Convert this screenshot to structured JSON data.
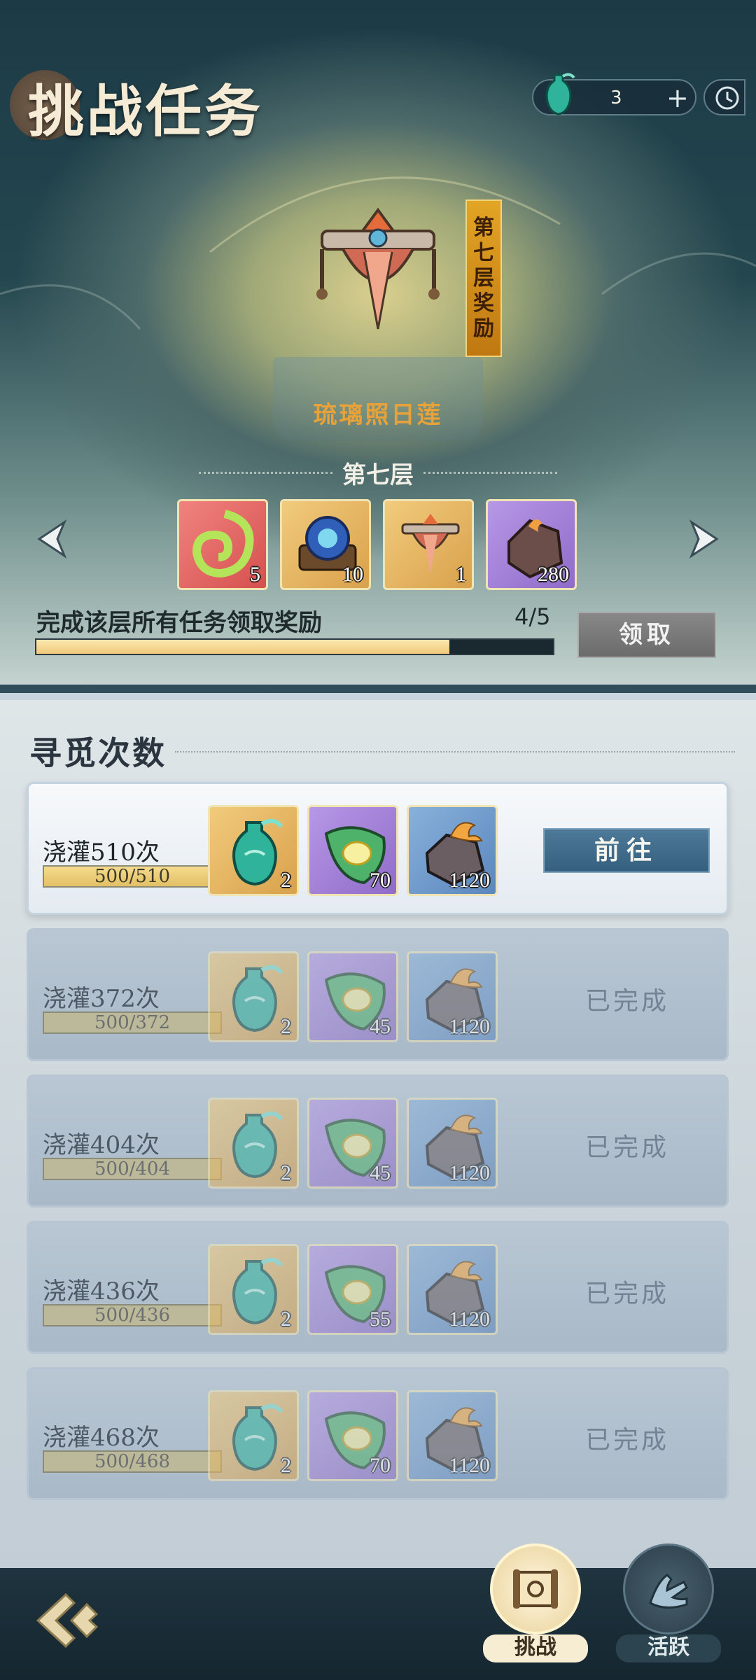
{
  "header": {
    "title": "挑战任务",
    "currency": {
      "icon": "jade-vase-icon",
      "count": "3",
      "plus": "+"
    },
    "clock_icon": "clock-icon"
  },
  "featured": {
    "item_name": "琉璃照日莲",
    "banner_chars": [
      "第",
      "七",
      "层",
      "奖",
      "励"
    ]
  },
  "floor": {
    "label": "第七层",
    "rewards": [
      {
        "icon": "green-swirl-emblem-icon",
        "qty": "5",
        "rarity": "red"
      },
      {
        "icon": "crystal-orb-box-icon",
        "qty": "10",
        "rarity": "gold"
      },
      {
        "icon": "ornate-headdress-icon",
        "qty": "1",
        "rarity": "gold"
      },
      {
        "icon": "ember-ore-icon",
        "qty": "280",
        "rarity": "purple"
      }
    ],
    "task_text": "完成该层所有任务领取奖励",
    "progress_text": "4/5",
    "progress_fraction": 0.8,
    "claim_label": "领取"
  },
  "section": {
    "title": "寻觅次数"
  },
  "tasks": [
    {
      "name": "浇灌510次",
      "progress": "500/510",
      "fraction": 0.98,
      "state": "active",
      "rewards": [
        {
          "icon": "jade-vase-icon",
          "qty": "2",
          "rarity": "gold"
        },
        {
          "icon": "leaf-gem-icon",
          "qty": "70",
          "rarity": "purple"
        },
        {
          "icon": "flame-ore-icon",
          "qty": "1120",
          "rarity": "blue"
        }
      ],
      "action": "前往"
    },
    {
      "name": "浇灌372次",
      "progress": "500/372",
      "fraction": 1,
      "state": "done",
      "rewards": [
        {
          "icon": "jade-vase-icon",
          "qty": "2",
          "rarity": "gold"
        },
        {
          "icon": "leaf-gem-icon",
          "qty": "45",
          "rarity": "purple"
        },
        {
          "icon": "flame-ore-icon",
          "qty": "1120",
          "rarity": "blue"
        }
      ],
      "action": "已完成"
    },
    {
      "name": "浇灌404次",
      "progress": "500/404",
      "fraction": 1,
      "state": "done",
      "rewards": [
        {
          "icon": "jade-vase-icon",
          "qty": "2",
          "rarity": "gold"
        },
        {
          "icon": "leaf-gem-icon",
          "qty": "45",
          "rarity": "purple"
        },
        {
          "icon": "flame-ore-icon",
          "qty": "1120",
          "rarity": "blue"
        }
      ],
      "action": "已完成"
    },
    {
      "name": "浇灌436次",
      "progress": "500/436",
      "fraction": 1,
      "state": "done",
      "rewards": [
        {
          "icon": "jade-vase-icon",
          "qty": "2",
          "rarity": "gold"
        },
        {
          "icon": "leaf-gem-icon",
          "qty": "55",
          "rarity": "purple"
        },
        {
          "icon": "flame-ore-icon",
          "qty": "1120",
          "rarity": "blue"
        }
      ],
      "action": "已完成"
    },
    {
      "name": "浇灌468次",
      "progress": "500/468",
      "fraction": 1,
      "state": "done",
      "rewards": [
        {
          "icon": "jade-vase-icon",
          "qty": "2",
          "rarity": "gold"
        },
        {
          "icon": "leaf-gem-icon",
          "qty": "70",
          "rarity": "purple"
        },
        {
          "icon": "flame-ore-icon",
          "qty": "1120",
          "rarity": "blue"
        }
      ],
      "action": "已完成"
    }
  ],
  "bottom_nav": {
    "back_icon": "back-arrow-icon",
    "tabs": [
      {
        "label": "挑战",
        "icon": "scroll-icon",
        "active": true
      },
      {
        "label": "活跃",
        "icon": "hand-gesture-icon",
        "active": false
      }
    ]
  }
}
